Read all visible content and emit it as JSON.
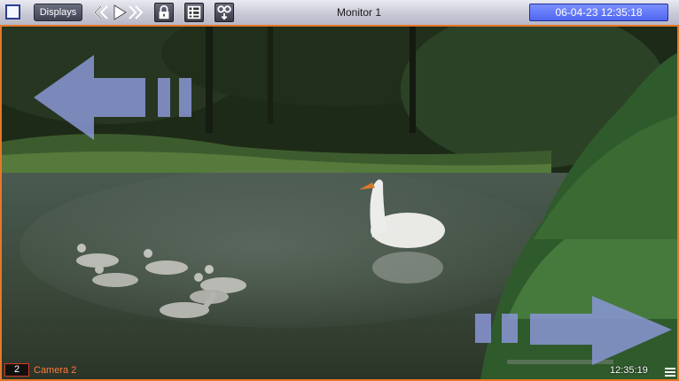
{
  "toolbar": {
    "displays_label": "Displays",
    "monitor_title": "Monitor 1",
    "clock": "06-04-23 12:35:18",
    "icons": [
      "square-select-icon",
      "rewind-icon",
      "play-icon",
      "fast-forward-icon",
      "lock-icon",
      "list-icon",
      "tape-download-icon"
    ]
  },
  "camera": {
    "number": "2",
    "name": "Camera 2",
    "time": "12:35:19",
    "border_color": "#e8772a",
    "icons": [
      "left-arrow-icon",
      "right-arrow-icon",
      "menu-icon"
    ]
  },
  "colors": {
    "clock_bg": "#5a6ff5",
    "overlay_arrow": "#8a96d6",
    "camera_label": "#ff7a3a"
  }
}
